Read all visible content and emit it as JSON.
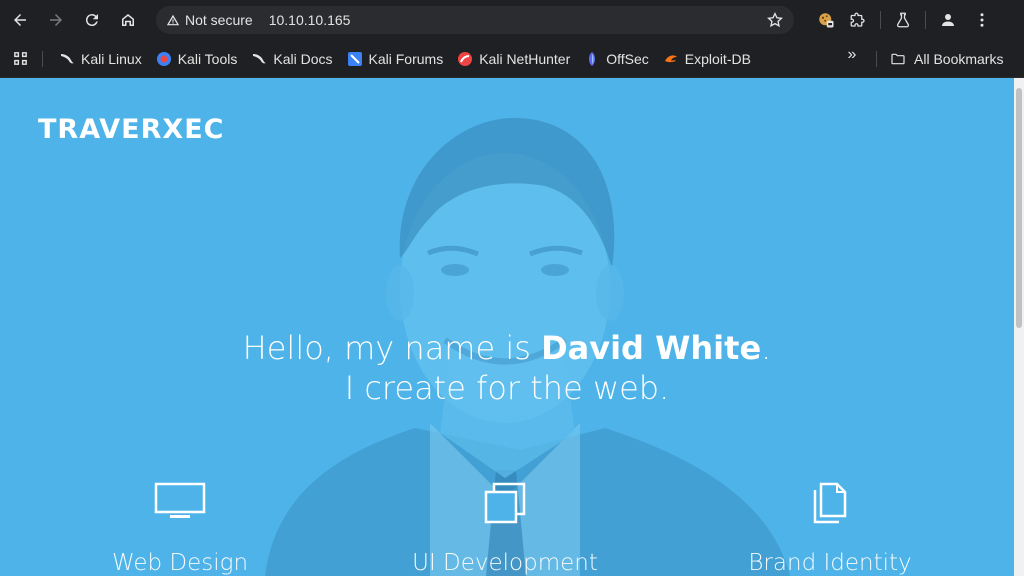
{
  "browser": {
    "security_label": "Not secure",
    "url": "10.10.10.165",
    "bookmarks": [
      {
        "label": "Kali Linux",
        "icon": "kali-dragon-icon",
        "color": "#e3e3e3"
      },
      {
        "label": "Kali Tools",
        "icon": "kali-tools-icon",
        "color": "#ef4444"
      },
      {
        "label": "Kali Docs",
        "icon": "kali-dragon-icon",
        "color": "#e3e3e3"
      },
      {
        "label": "Kali Forums",
        "icon": "kali-forums-icon",
        "color": "#3b82f6"
      },
      {
        "label": "Kali NetHunter",
        "icon": "nethunter-icon",
        "color": "#ef4444"
      },
      {
        "label": "OffSec",
        "icon": "offsec-icon",
        "color": "#6366f1"
      },
      {
        "label": "Exploit-DB",
        "icon": "exploit-db-icon",
        "color": "#f97316"
      }
    ],
    "bookmarks_overflow": "»",
    "all_bookmarks_label": "All Bookmarks"
  },
  "page": {
    "brand": "TRAVERXEC",
    "headline_prefix": "Hello, my name is ",
    "headline_name": "David White",
    "headline_suffix": ".",
    "headline_line2": "I create for the web.",
    "services": [
      {
        "label": "Web Design",
        "icon": "monitor-icon"
      },
      {
        "label": "UI Development",
        "icon": "stacked-squares-icon"
      },
      {
        "label": "Brand Identity",
        "icon": "documents-icon"
      }
    ],
    "accent_color": "#4db3e8"
  }
}
